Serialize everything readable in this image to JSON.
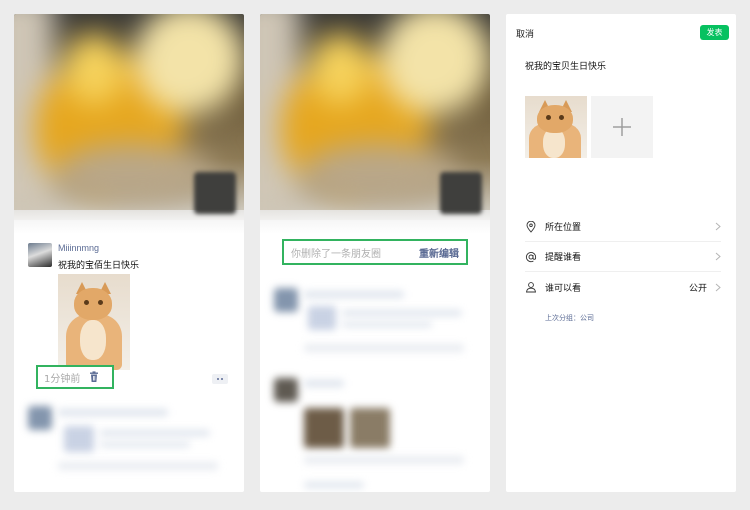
{
  "panel1": {
    "username": "Miiinnmng",
    "post_text": "祝我的宝佰生日快乐",
    "time_ago": "1分钟前"
  },
  "panel2": {
    "deleted_notice": "你删除了一条朋友圈",
    "reedit_label": "重新编辑"
  },
  "panel3": {
    "cancel_label": "取消",
    "publish_label": "发表",
    "compose_text": "祝我的宝贝生日快乐",
    "options": [
      {
        "icon": "location-icon",
        "label": "所在位置",
        "value": ""
      },
      {
        "icon": "at-icon",
        "label": "提醒谁看",
        "value": ""
      },
      {
        "icon": "person-icon",
        "label": "谁可以看",
        "value": "公开"
      }
    ],
    "last_group": "上次分组：公司"
  },
  "colors": {
    "accent_green": "#07c160",
    "highlight_border": "#32b35f",
    "link_blue": "#5b6b94"
  }
}
